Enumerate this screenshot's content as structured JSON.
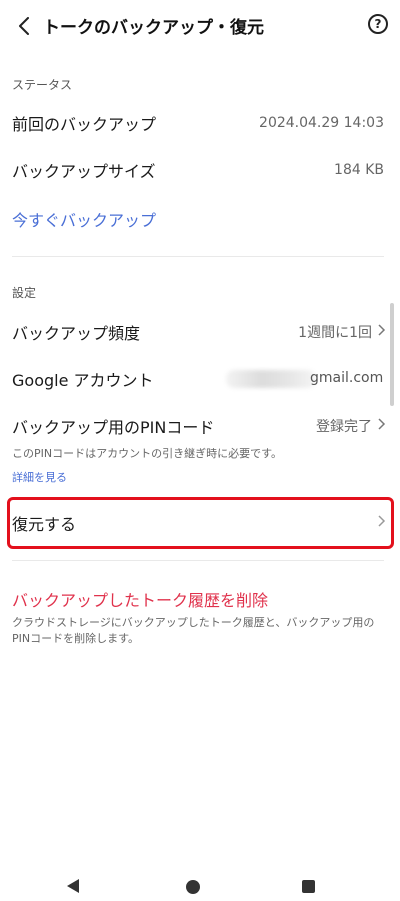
{
  "header": {
    "back_icon": "chevron-left-icon",
    "title": "トークのバックアップ・復元",
    "help_icon": "help-circle-icon",
    "help_glyph": "?"
  },
  "status": {
    "section_label": "ステータス",
    "last_backup_label": "前回のバックアップ",
    "last_backup_value": "2024.04.29 14:03",
    "backup_size_label": "バックアップサイズ",
    "backup_size_value": "184 KB",
    "backup_now": "今すぐバックアップ"
  },
  "settings": {
    "section_label": "設定",
    "frequency_label": "バックアップ頻度",
    "frequency_value": "1週間に1回",
    "google_label": "Google アカウント",
    "google_value_suffix": "gmail.com",
    "pin_label": "バックアップ用のPINコード",
    "pin_value": "登録完了",
    "pin_note": "このPINコードはアカウントの引き継ぎ時に必要です。",
    "details_link": "詳細を見る",
    "restore_label": "復元する"
  },
  "danger": {
    "delete_label": "バックアップしたトーク履歴を削除",
    "delete_desc": "クラウドストレージにバックアップしたトーク履歴と、バックアップ用のPINコードを削除します。"
  },
  "colors": {
    "link": "#4a6fd6",
    "danger": "#e0324c",
    "highlight": "#e3101c"
  }
}
